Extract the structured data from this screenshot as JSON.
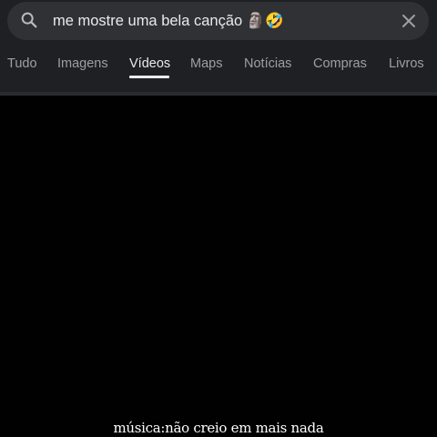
{
  "search": {
    "query": "me mostre uma bela canção 🗿🤣"
  },
  "tabs": [
    {
      "label": "Tudo",
      "active": false
    },
    {
      "label": "Imagens",
      "active": false
    },
    {
      "label": "Vídeos",
      "active": true
    },
    {
      "label": "Maps",
      "active": false
    },
    {
      "label": "Notícias",
      "active": false
    },
    {
      "label": "Compras",
      "active": false
    },
    {
      "label": "Livros",
      "active": false
    }
  ],
  "icons": {
    "search": "search-icon",
    "clear": "close-icon"
  },
  "video": {
    "caption": "música:não creio em mais nada"
  },
  "colors": {
    "header_bg": "#1f2023",
    "search_bg": "#303134",
    "video_bg": "#010101",
    "active_tab": "#e8eaed",
    "inactive_tab": "#9aa0a6"
  }
}
